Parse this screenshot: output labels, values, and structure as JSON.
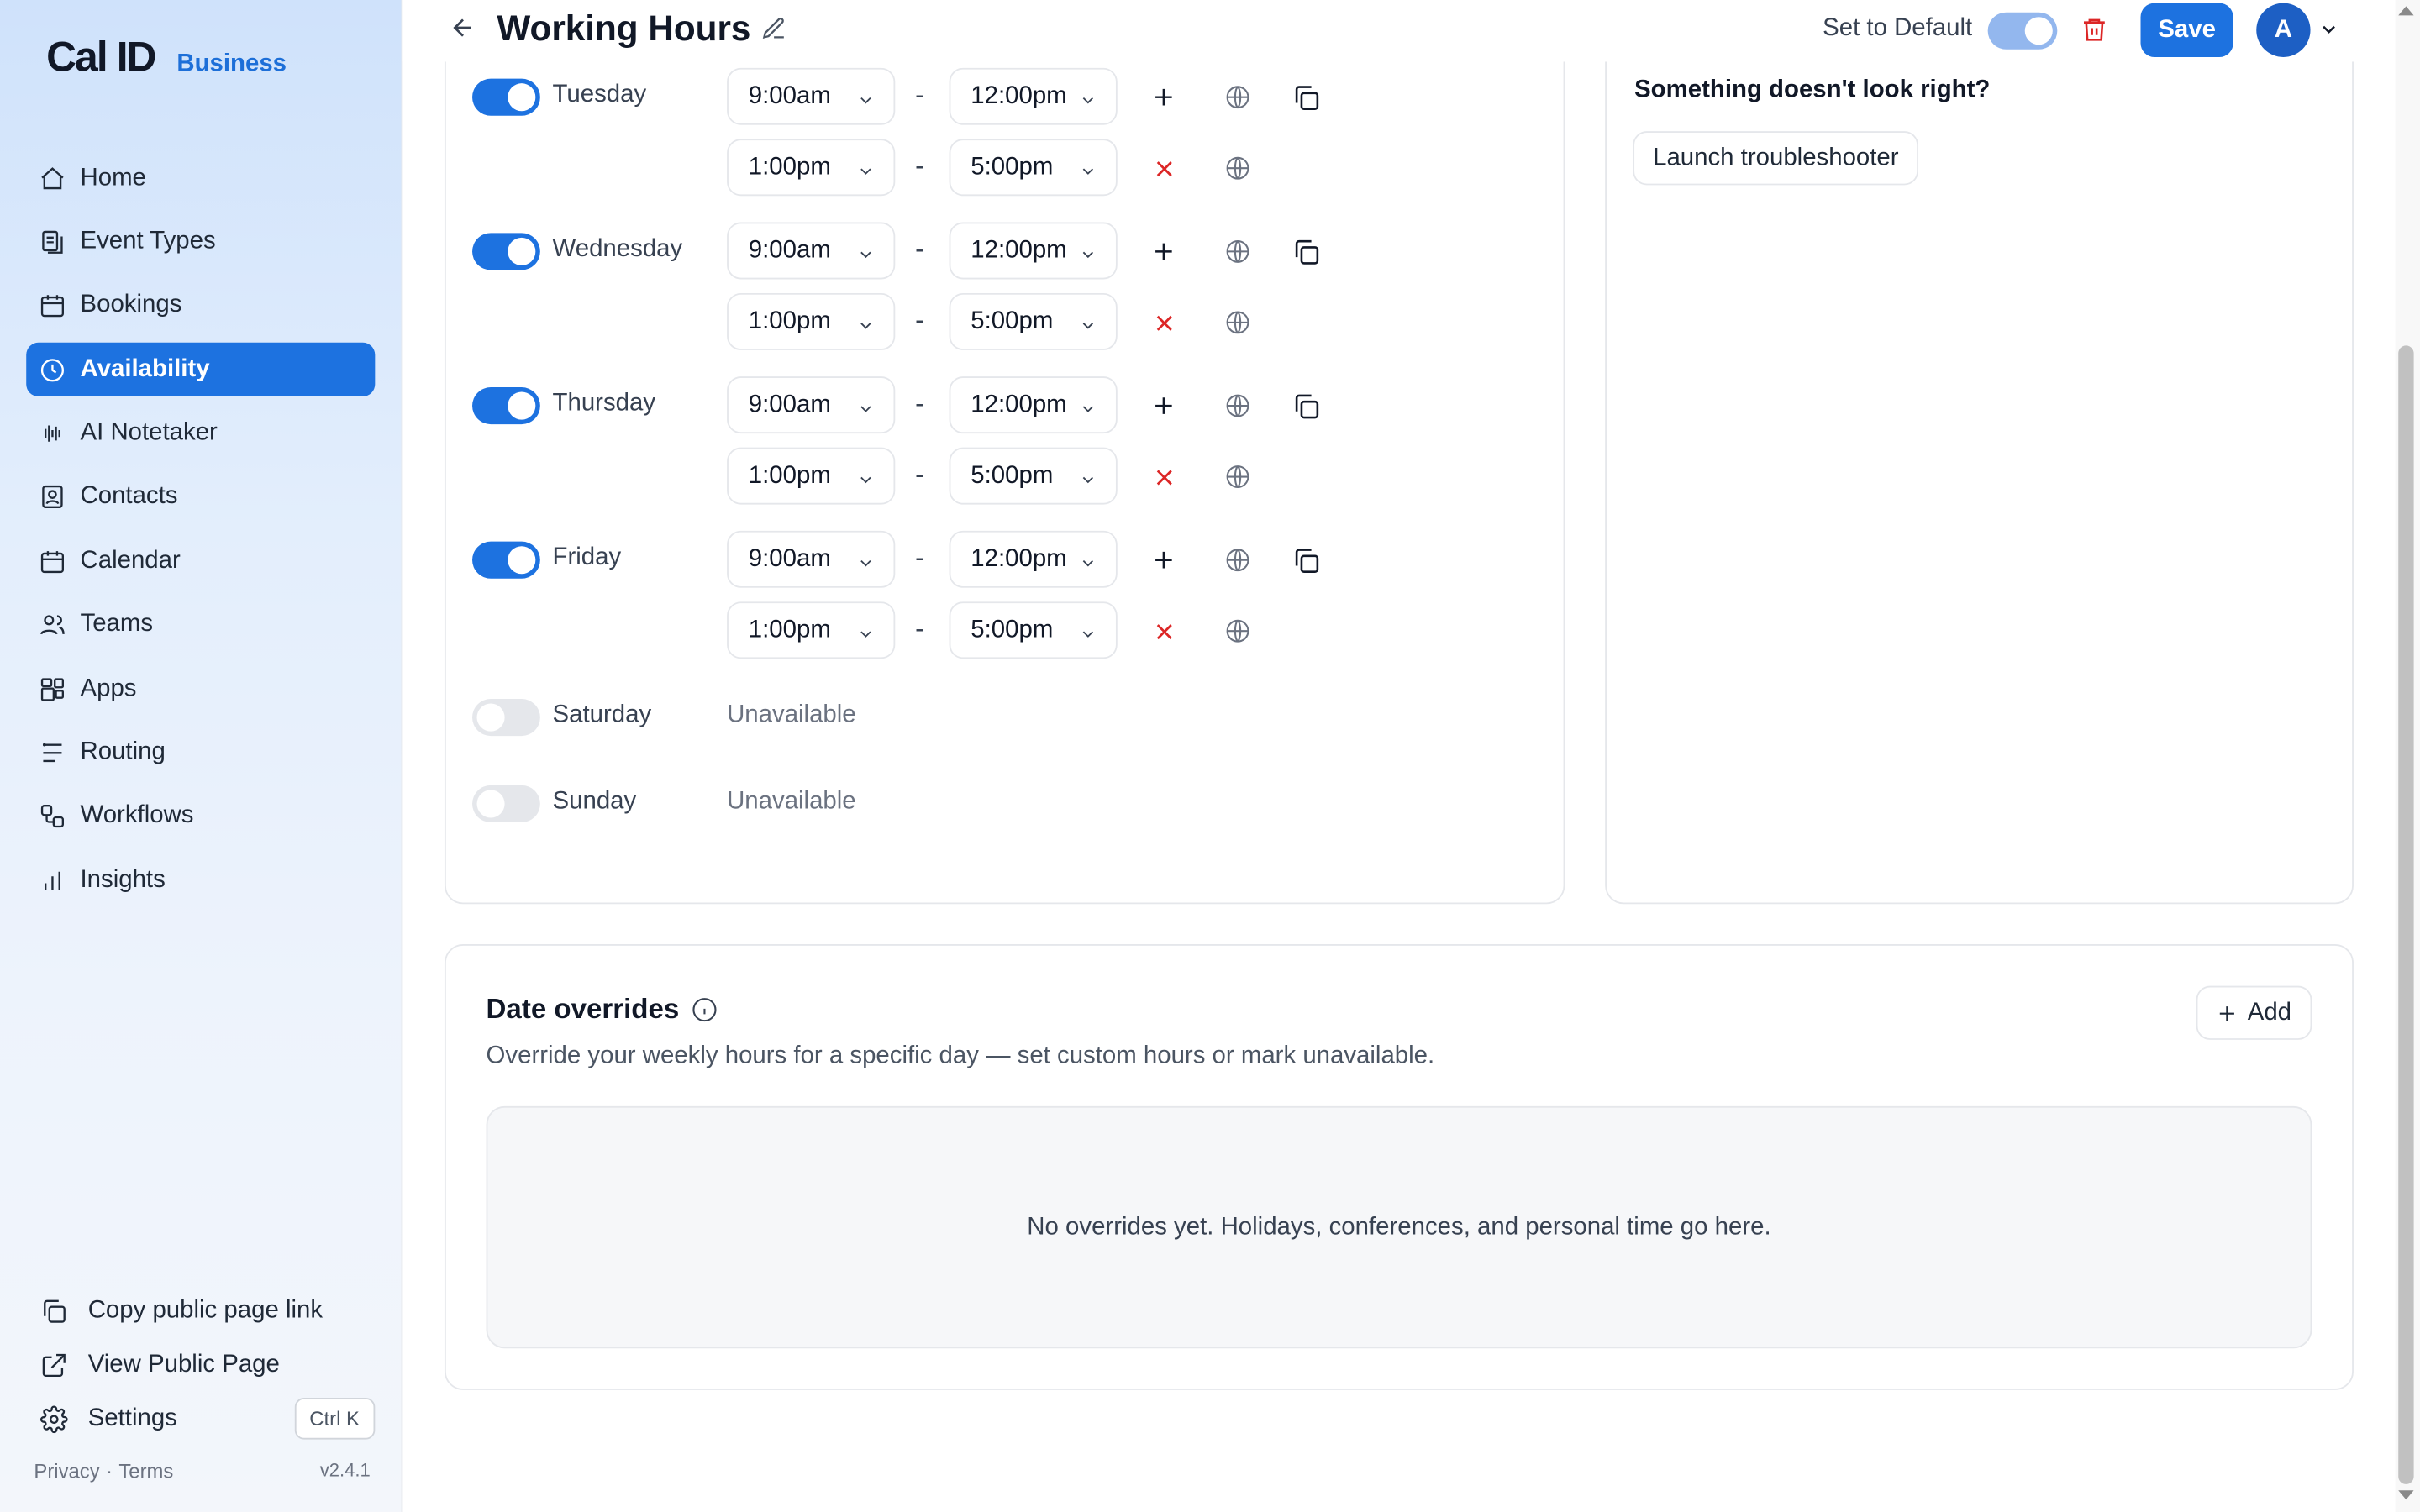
{
  "brand": {
    "logo": "Cal ID",
    "tier": "Business"
  },
  "sidebar": {
    "items": [
      {
        "label": "Home",
        "icon": "home-icon"
      },
      {
        "label": "Event Types",
        "icon": "event-types-icon"
      },
      {
        "label": "Bookings",
        "icon": "calendar-icon"
      },
      {
        "label": "Availability",
        "icon": "clock-icon",
        "active": true
      },
      {
        "label": "AI Notetaker",
        "icon": "waveform-icon"
      },
      {
        "label": "Contacts",
        "icon": "contact-icon"
      },
      {
        "label": "Calendar",
        "icon": "calendar-icon"
      },
      {
        "label": "Teams",
        "icon": "users-icon"
      },
      {
        "label": "Apps",
        "icon": "apps-icon"
      },
      {
        "label": "Routing",
        "icon": "routing-icon"
      },
      {
        "label": "Workflows",
        "icon": "workflow-icon"
      },
      {
        "label": "Insights",
        "icon": "bar-chart-icon"
      }
    ],
    "bottom": {
      "copy_link": "Copy public page link",
      "view_public": "View Public Page",
      "settings": "Settings",
      "shortcut": "Ctrl K"
    },
    "footer": {
      "privacy": "Privacy",
      "sep": "·",
      "terms": "Terms",
      "version": "v2.4.1"
    }
  },
  "header": {
    "title": "Working Hours",
    "set_default_label": "Set to Default",
    "set_default_on": true,
    "save_label": "Save",
    "avatar_initial": "A"
  },
  "schedule": {
    "dash": "-",
    "unavailable_label": "Unavailable",
    "days": [
      {
        "day": "Tuesday",
        "enabled": true,
        "slots": [
          [
            "9:00am",
            "12:00pm"
          ],
          [
            "1:00pm",
            "5:00pm"
          ]
        ]
      },
      {
        "day": "Wednesday",
        "enabled": true,
        "slots": [
          [
            "9:00am",
            "12:00pm"
          ],
          [
            "1:00pm",
            "5:00pm"
          ]
        ]
      },
      {
        "day": "Thursday",
        "enabled": true,
        "slots": [
          [
            "9:00am",
            "12:00pm"
          ],
          [
            "1:00pm",
            "5:00pm"
          ]
        ]
      },
      {
        "day": "Friday",
        "enabled": true,
        "slots": [
          [
            "9:00am",
            "12:00pm"
          ],
          [
            "1:00pm",
            "5:00pm"
          ]
        ]
      },
      {
        "day": "Saturday",
        "enabled": false,
        "slots": []
      },
      {
        "day": "Sunday",
        "enabled": false,
        "slots": []
      }
    ]
  },
  "troubleshooter": {
    "question": "Something doesn't look right?",
    "button": "Launch troubleshooter"
  },
  "overrides": {
    "title": "Date overrides",
    "description": "Override your weekly hours for a specific day — set custom hours or mark unavailable.",
    "add_label": "Add",
    "empty_text": "No overrides yet. Holidays, conferences, and personal time go here."
  },
  "colors": {
    "accent": "#1d72e0",
    "remove": "#dc2626",
    "trash": "#dc2626"
  }
}
